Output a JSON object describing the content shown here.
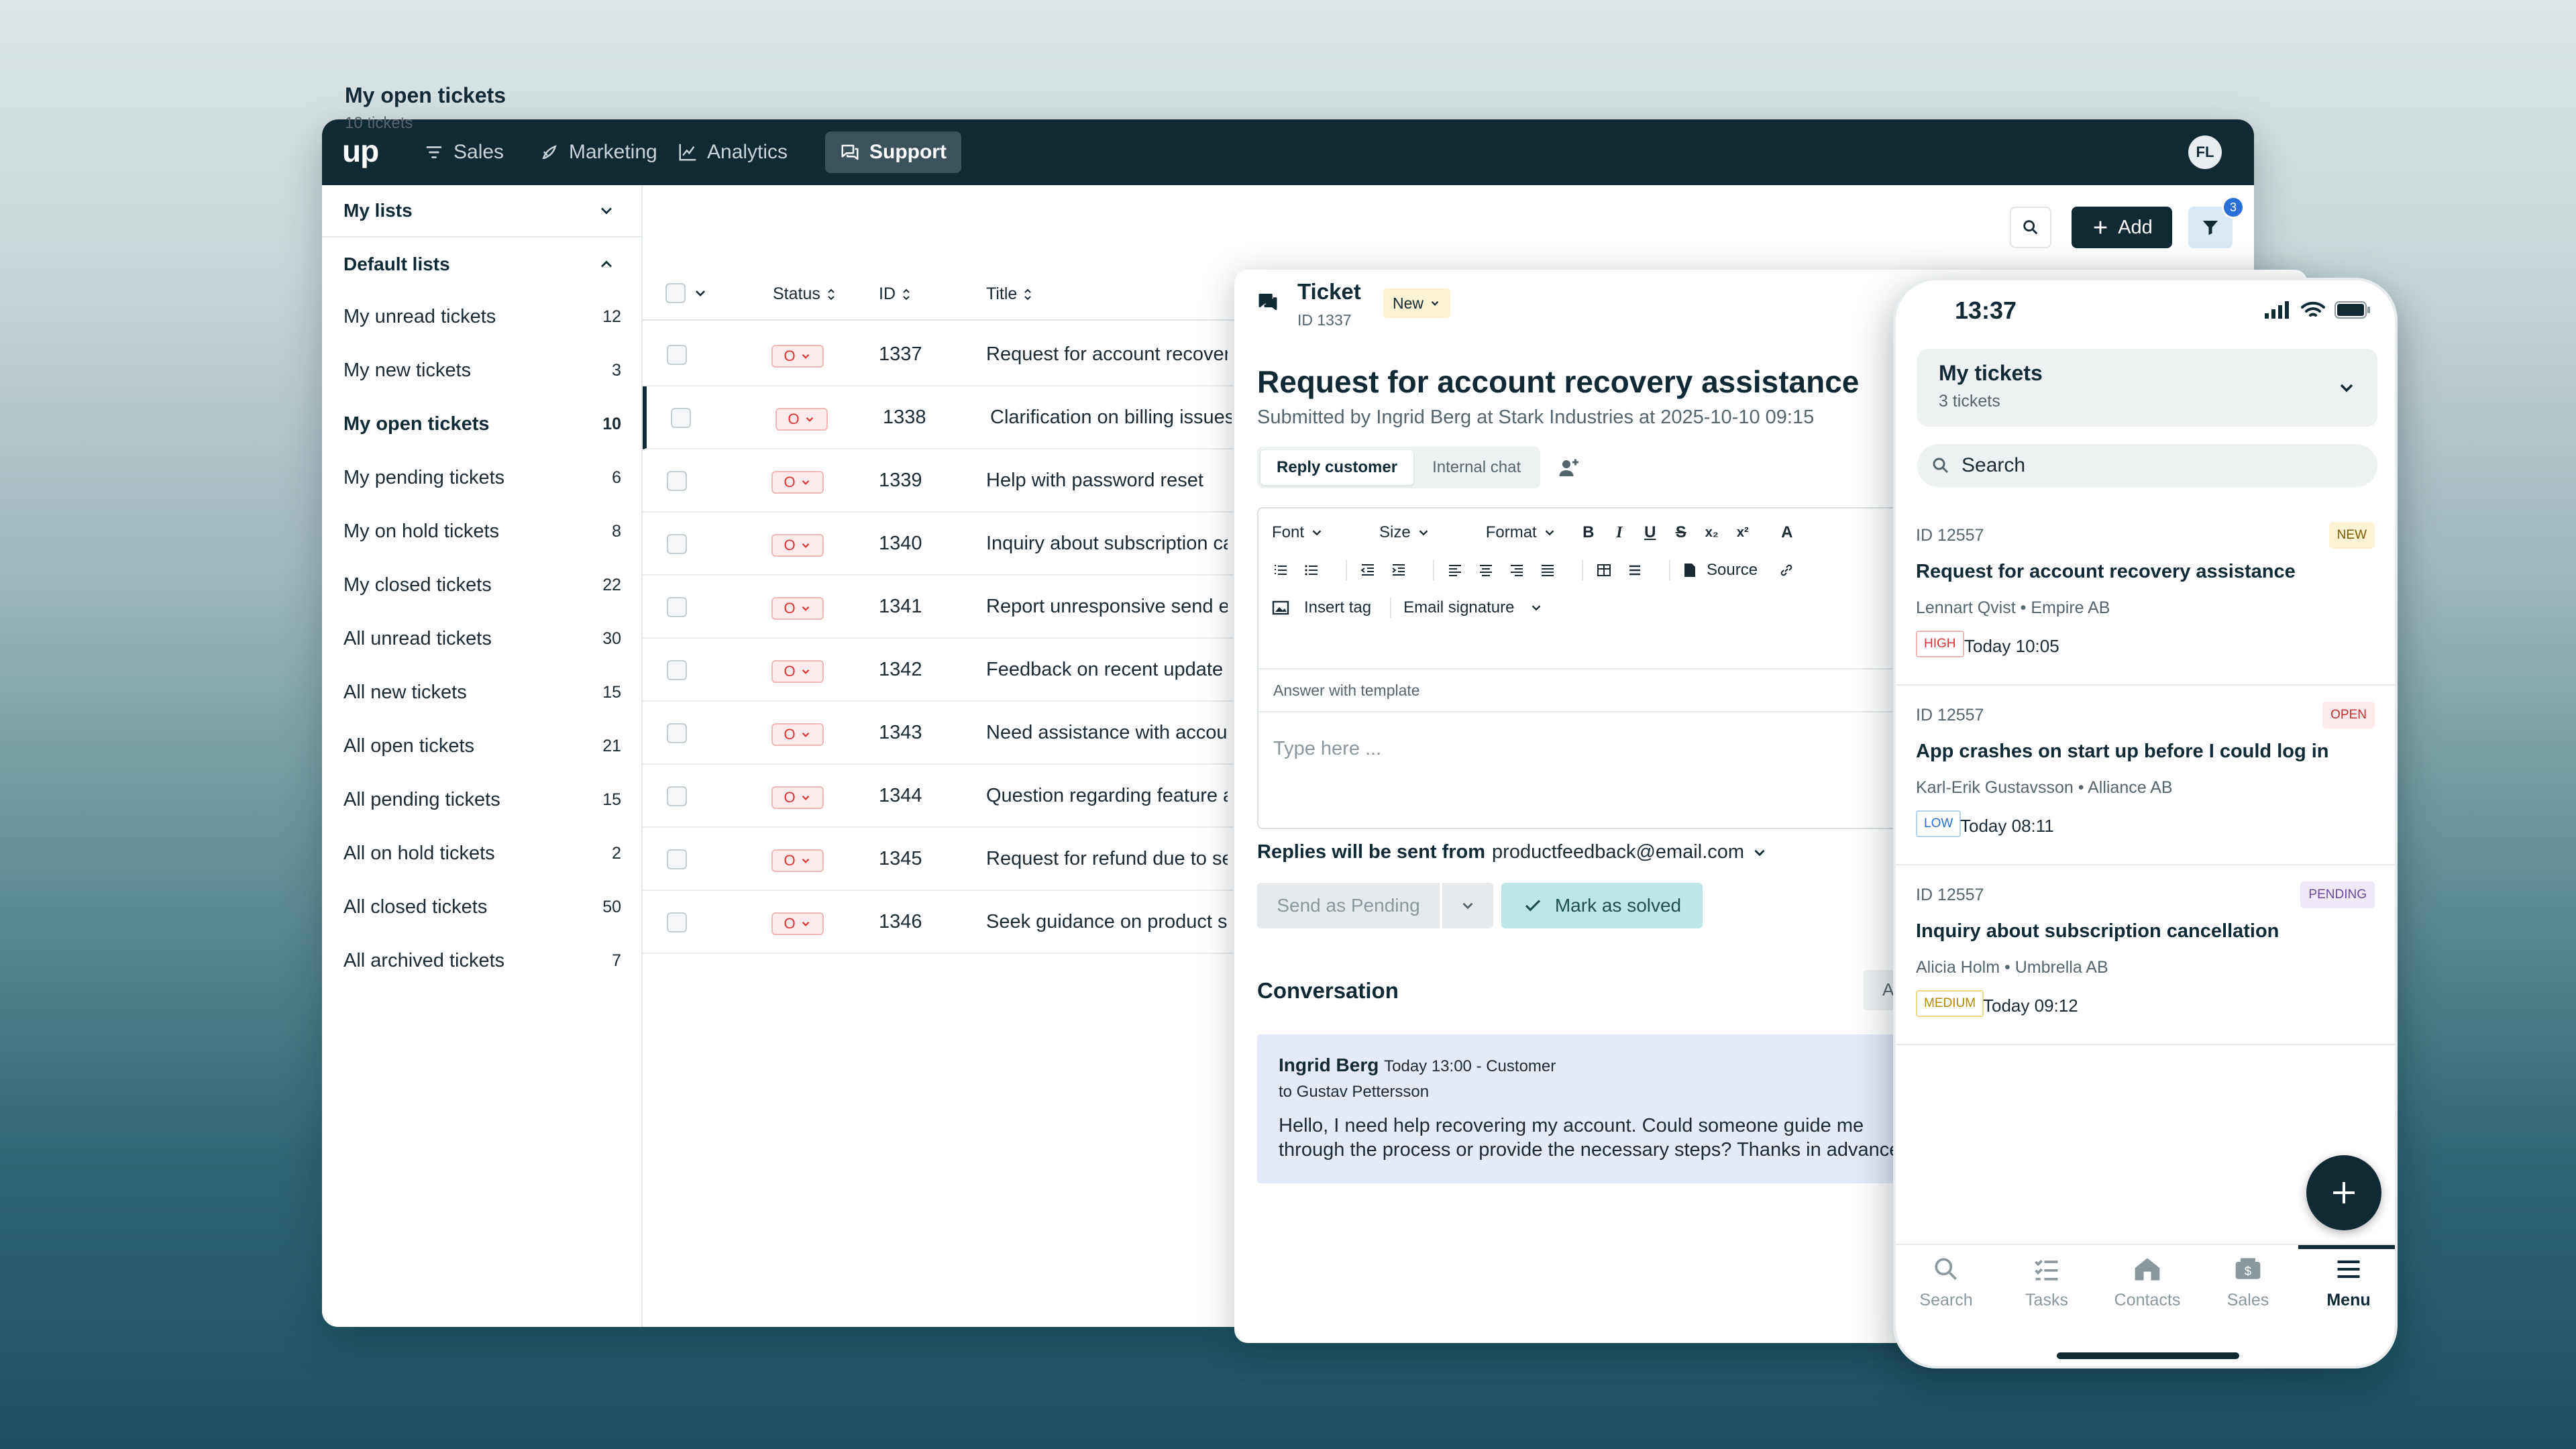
{
  "app": {
    "logo": "up",
    "nav": [
      {
        "label": "Sales",
        "icon": "filter-icon"
      },
      {
        "label": "Marketing",
        "icon": "rocket-icon"
      },
      {
        "label": "Analytics",
        "icon": "chart-icon"
      },
      {
        "label": "Support",
        "icon": "chat-icon",
        "active": true
      }
    ],
    "avatar_initials": "FL"
  },
  "sidebar": {
    "my_lists": "My lists",
    "default_lists": "Default lists",
    "items": [
      {
        "label": "My unread tickets",
        "count": "12"
      },
      {
        "label": "My new tickets",
        "count": "3"
      },
      {
        "label": "My open tickets",
        "count": "10",
        "active": true
      },
      {
        "label": "My pending tickets",
        "count": "6"
      },
      {
        "label": "My on hold tickets",
        "count": "8"
      },
      {
        "label": "My closed tickets",
        "count": "22"
      },
      {
        "label": "All unread tickets",
        "count": "30"
      },
      {
        "label": "All new tickets",
        "count": "15"
      },
      {
        "label": "All open tickets",
        "count": "21"
      },
      {
        "label": "All pending tickets",
        "count": "15"
      },
      {
        "label": "All on hold tickets",
        "count": "2"
      },
      {
        "label": "All closed tickets",
        "count": "50"
      },
      {
        "label": "All archived tickets",
        "count": "7"
      }
    ]
  },
  "list": {
    "title": "My open tickets",
    "subtitle": "10 tickets",
    "columns": [
      "Status",
      "ID",
      "Title"
    ],
    "add_label": "Add",
    "filter_count": "3",
    "rows": [
      {
        "status": "O",
        "id": "1337",
        "title": "Request for account recovery assistance"
      },
      {
        "status": "O",
        "id": "1338",
        "title": "Clarification on billing issues"
      },
      {
        "status": "O",
        "id": "1339",
        "title": "Help with password reset"
      },
      {
        "status": "O",
        "id": "1340",
        "title": "Inquiry about subscription cancellation"
      },
      {
        "status": "O",
        "id": "1341",
        "title": "Report unresponsive send email"
      },
      {
        "status": "O",
        "id": "1342",
        "title": "Feedback on recent update"
      },
      {
        "status": "O",
        "id": "1343",
        "title": "Need assistance with account"
      },
      {
        "status": "O",
        "id": "1344",
        "title": "Question regarding feature availability"
      },
      {
        "status": "O",
        "id": "1345",
        "title": "Request for refund due to service"
      },
      {
        "status": "O",
        "id": "1346",
        "title": "Seek guidance on product setup"
      }
    ]
  },
  "ticket": {
    "label": "Ticket",
    "id": "ID 1337",
    "state": "New",
    "title": "Request for account recovery assistance",
    "submitted": "Submitted by Ingrid Berg at Stark Industries at 2025-10-10 09:15",
    "tabs": [
      "Reply customer",
      "Internal chat"
    ],
    "toolbar": {
      "font": "Font",
      "size": "Size",
      "format": "Format",
      "source": "Source",
      "insert_tag": "Insert tag",
      "email_signature": "Email signature"
    },
    "template_label": "Answer with template",
    "placeholder": "Type here ...",
    "replies_prefix": "Replies will be sent from",
    "reply_email": "productfeedback@email.com",
    "send_pending": "Send as Pending",
    "mark_solved": "Mark as solved",
    "conversation_title": "Conversation",
    "conversation_btn": "A",
    "message": {
      "author": "Ingrid Berg",
      "meta": "Today 13:00 - Customer",
      "to": "to Gustav Pettersson",
      "body": "Hello, I need help recovering my account. Could someone guide me through the process or provide the necessary steps? Thanks in advance!"
    }
  },
  "phone": {
    "time": "13:37",
    "title": "My tickets",
    "count": "3 tickets",
    "search_placeholder": "Search",
    "cards": [
      {
        "id": "ID 12557",
        "state": "NEW",
        "title": "Request for account recovery assistance",
        "person": "Lennart Qvist",
        "company": "Empire AB",
        "priority": "HIGH",
        "time": "Today 10:05"
      },
      {
        "id": "ID 12557",
        "state": "OPEN",
        "title": "App crashes on start up before I could log in",
        "person": "Karl-Erik Gustavsson",
        "company": "Alliance AB",
        "priority": "LOW",
        "time": "Today 08:11"
      },
      {
        "id": "ID 12557",
        "state": "PENDING",
        "title": "Inquiry about subscription cancellation",
        "person": "Alicia Holm",
        "company": "Umbrella AB",
        "priority": "MEDIUM",
        "time": "Today 09:12"
      }
    ],
    "tabs": [
      "Search",
      "Tasks",
      "Contacts",
      "Sales",
      "Menu"
    ],
    "separator": "•"
  },
  "colors": {
    "nav_bg": "#102a35",
    "accent": "#2a6fd6",
    "danger": "#d33333",
    "solved": "#bfe6e6"
  }
}
